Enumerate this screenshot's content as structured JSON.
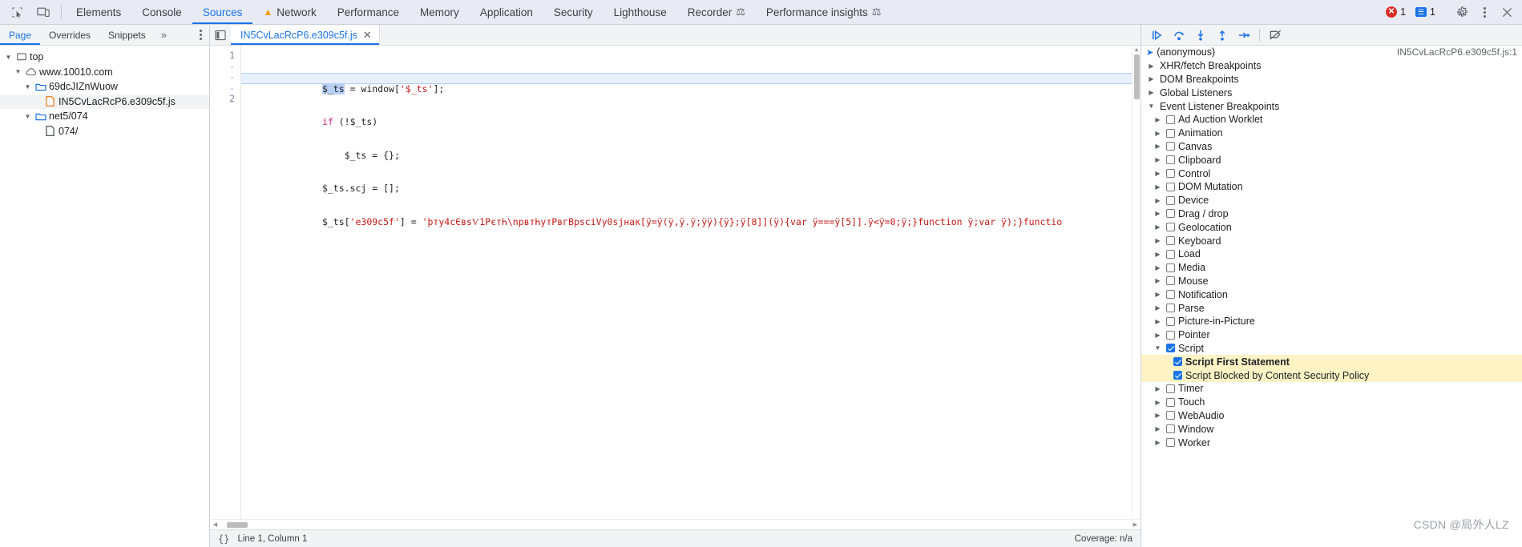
{
  "toolbar": {
    "icons": [
      {
        "name": "inspect-element-icon",
        "glyph": "inspect"
      },
      {
        "name": "device-toolbar-icon",
        "glyph": "device"
      }
    ],
    "tabs": [
      {
        "label": "Elements",
        "active": false,
        "icon": ""
      },
      {
        "label": "Console",
        "active": false,
        "icon": ""
      },
      {
        "label": "Sources",
        "active": true,
        "icon": ""
      },
      {
        "label": "Network",
        "active": false,
        "icon": "warning-triangle"
      },
      {
        "label": "Performance",
        "active": false,
        "icon": ""
      },
      {
        "label": "Memory",
        "active": false,
        "icon": ""
      },
      {
        "label": "Application",
        "active": false,
        "icon": ""
      },
      {
        "label": "Security",
        "active": false,
        "icon": ""
      },
      {
        "label": "Lighthouse",
        "active": false,
        "icon": ""
      },
      {
        "label": "Recorder",
        "active": false,
        "icon": "flask"
      },
      {
        "label": "Performance insights",
        "active": false,
        "icon": "flask"
      }
    ],
    "error_count": "1",
    "message_count": "1",
    "settings_label": "Settings",
    "more_label": "More options",
    "close_label": "Close DevTools"
  },
  "navigator": {
    "tabs": [
      {
        "label": "Page",
        "active": true
      },
      {
        "label": "Overrides",
        "active": false
      },
      {
        "label": "Snippets",
        "active": false
      }
    ],
    "more_label": "»",
    "tree": [
      {
        "label": "top",
        "icon": "frame-icon",
        "depth": 0,
        "twisty": "▼",
        "selected": false
      },
      {
        "label": "www.10010.com",
        "icon": "cloud-icon",
        "depth": 1,
        "twisty": "▼",
        "selected": false
      },
      {
        "label": "69dcJIZnWuow",
        "icon": "folder-icon",
        "depth": 2,
        "twisty": "▼",
        "selected": false
      },
      {
        "label": "IN5CvLacRcP6.e309c5f.js",
        "icon": "js-file-icon",
        "depth": 3,
        "twisty": "",
        "selected": true
      },
      {
        "label": "net5/074",
        "icon": "folder-icon",
        "depth": 2,
        "twisty": "▼",
        "selected": false
      },
      {
        "label": "074/",
        "icon": "file-icon",
        "depth": 3,
        "twisty": "",
        "selected": false
      }
    ]
  },
  "editor": {
    "tab_label": "IN5CvLacRcP6.e309c5f.js",
    "close_glyph": "✕",
    "gutter": [
      "1",
      "-",
      "-",
      "-",
      "2"
    ],
    "lines": [
      {
        "active": true,
        "parts": [
          {
            "text": "$_ts",
            "style": "sel"
          },
          {
            "text": " = window[",
            "style": "plain"
          },
          {
            "text": "'$_ts'",
            "style": "str"
          },
          {
            "text": "];",
            "style": "plain"
          }
        ]
      },
      {
        "active": false,
        "parts": [
          {
            "text": "if",
            "style": "kw"
          },
          {
            "text": " (!$_ts)",
            "style": "plain"
          }
        ]
      },
      {
        "active": false,
        "parts": [
          {
            "text": "    $_ts = {};",
            "style": "plain"
          }
        ]
      },
      {
        "active": false,
        "parts": [
          {
            "text": "$_ts.scj = [];",
            "style": "plain"
          }
        ]
      },
      {
        "active": false,
        "parts": [
          {
            "text": "$_ts[",
            "style": "plain"
          },
          {
            "text": "'e309c5f'",
            "style": "str"
          },
          {
            "text": "] = ",
            "style": "plain"
          },
          {
            "text": "'þту4сЄвѕѴ1РєтҺ\\nрвтҺутРвгВрѕсіVу0ѕјнак[ÿ=ÿ(ÿ,ÿ.ÿ;ÿÿ){ÿ};ÿ[8]](ÿ){var ÿ===ÿ[5]].ÿ<ÿ=0;ÿ;}function ÿ;var ÿ);}functio",
            "style": "obf"
          }
        ]
      }
    ],
    "status_left": "Line 1, Column 1",
    "status_right": "Coverage: n/a",
    "pretty_print_glyph": "{}"
  },
  "debugger": {
    "toolbar": [
      {
        "name": "resume-script-button",
        "glyph": "resume"
      },
      {
        "name": "step-over-button",
        "glyph": "step-over"
      },
      {
        "name": "step-into-button",
        "glyph": "step-into"
      },
      {
        "name": "step-out-button",
        "glyph": "step-out"
      },
      {
        "name": "step-button",
        "glyph": "step"
      },
      {
        "name": "deactivate-breakpoints-button",
        "glyph": "deactivate"
      }
    ],
    "call_frame": {
      "label": "(anonymous)",
      "location": "IN5CvLacRcP6.e309c5f.js:1"
    },
    "sections": [
      {
        "label": "XHR/fetch Breakpoints",
        "expanded": false
      },
      {
        "label": "DOM Breakpoints",
        "expanded": false
      },
      {
        "label": "Global Listeners",
        "expanded": false
      },
      {
        "label": "Event Listener Breakpoints",
        "expanded": true
      }
    ],
    "event_categories": [
      {
        "label": "Ad Auction Worklet",
        "checked": false,
        "highlight": false,
        "indent": 1
      },
      {
        "label": "Animation",
        "checked": false,
        "highlight": false,
        "indent": 1
      },
      {
        "label": "Canvas",
        "checked": false,
        "highlight": false,
        "indent": 1
      },
      {
        "label": "Clipboard",
        "checked": false,
        "highlight": false,
        "indent": 1
      },
      {
        "label": "Control",
        "checked": false,
        "highlight": false,
        "indent": 1
      },
      {
        "label": "DOM Mutation",
        "checked": false,
        "highlight": false,
        "indent": 1
      },
      {
        "label": "Device",
        "checked": false,
        "highlight": false,
        "indent": 1
      },
      {
        "label": "Drag / drop",
        "checked": false,
        "highlight": false,
        "indent": 1
      },
      {
        "label": "Geolocation",
        "checked": false,
        "highlight": false,
        "indent": 1
      },
      {
        "label": "Keyboard",
        "checked": false,
        "highlight": false,
        "indent": 1
      },
      {
        "label": "Load",
        "checked": false,
        "highlight": false,
        "indent": 1
      },
      {
        "label": "Media",
        "checked": false,
        "highlight": false,
        "indent": 1
      },
      {
        "label": "Mouse",
        "checked": false,
        "highlight": false,
        "indent": 1
      },
      {
        "label": "Notification",
        "checked": false,
        "highlight": false,
        "indent": 1
      },
      {
        "label": "Parse",
        "checked": false,
        "highlight": false,
        "indent": 1
      },
      {
        "label": "Picture-in-Picture",
        "checked": false,
        "highlight": false,
        "indent": 1
      },
      {
        "label": "Pointer",
        "checked": false,
        "highlight": false,
        "indent": 1
      },
      {
        "label": "Script",
        "checked": true,
        "highlight": false,
        "indent": 1,
        "expanded": true
      },
      {
        "label": "Script First Statement",
        "checked": true,
        "highlight": true,
        "indent": 2
      },
      {
        "label": "Script Blocked by Content Security Policy",
        "checked": true,
        "highlight": true,
        "indent": 2
      },
      {
        "label": "Timer",
        "checked": false,
        "highlight": false,
        "indent": 1
      },
      {
        "label": "Touch",
        "checked": false,
        "highlight": false,
        "indent": 1
      },
      {
        "label": "WebAudio",
        "checked": false,
        "highlight": false,
        "indent": 1
      },
      {
        "label": "Window",
        "checked": false,
        "highlight": false,
        "indent": 1
      },
      {
        "label": "Worker",
        "checked": false,
        "highlight": false,
        "indent": 1
      }
    ]
  },
  "watermark": "CSDN @局外人LZ",
  "colors": {
    "accent": "#1a73e8",
    "error": "#d93025",
    "warning": "#f29900",
    "highlight": "#fdf3c4",
    "toolbar_bg": "#e8ebf4"
  }
}
